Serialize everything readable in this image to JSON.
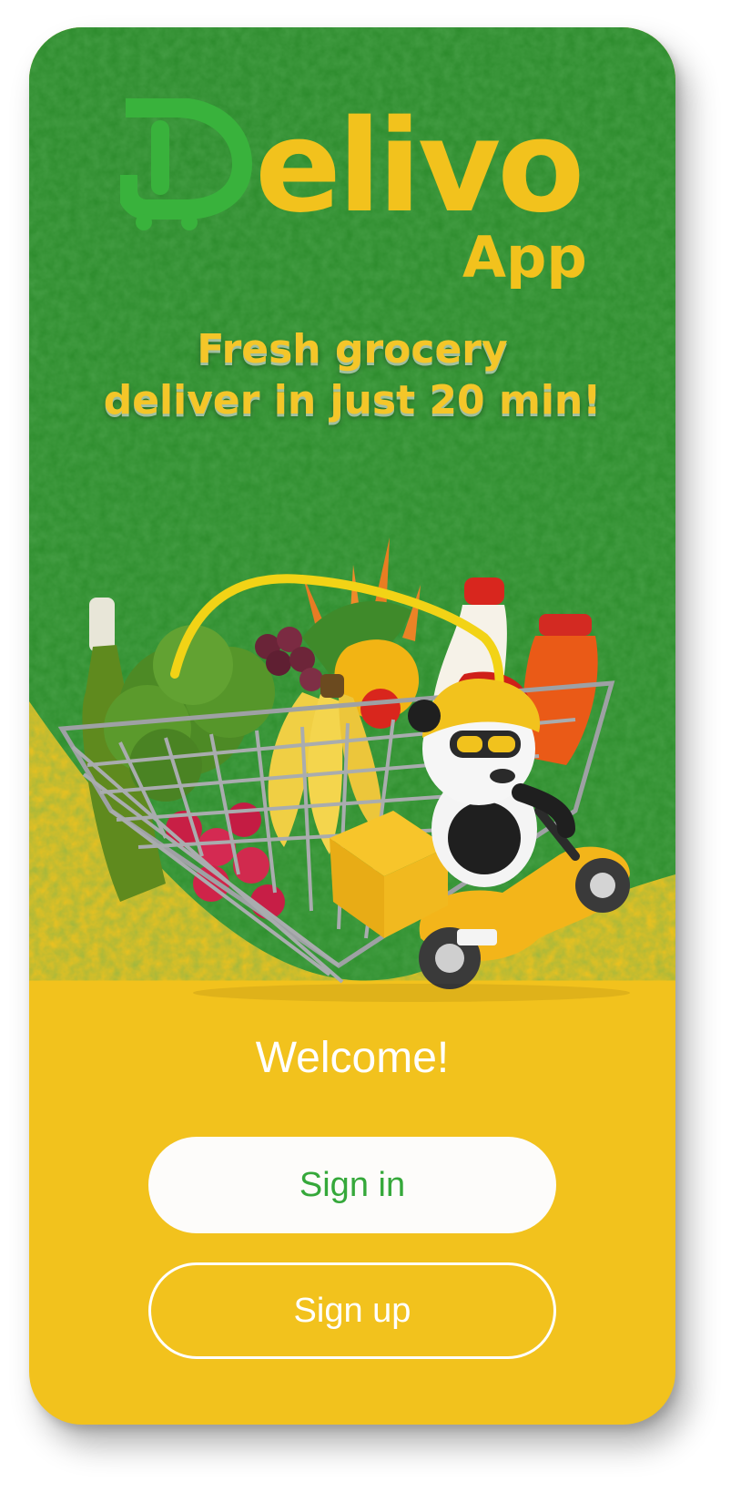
{
  "brand": {
    "name": "Delivo",
    "name_rest": "elivo",
    "sub": "App",
    "logo_icon": "cart-d-icon"
  },
  "hero": {
    "tagline_line1": "Fresh grocery",
    "tagline_line2": "deliver in just 20 min!",
    "illustration": "grocery-basket-panda-scooter-illustration"
  },
  "welcome": {
    "text": "Welcome!"
  },
  "actions": {
    "signin_label": "Sign in",
    "signup_label": "Sign up"
  },
  "colors": {
    "brand_green": "#2d8a2b",
    "logo_green": "#39b23c",
    "brand_yellow": "#f2c21d",
    "signin_text": "#35a83a"
  }
}
